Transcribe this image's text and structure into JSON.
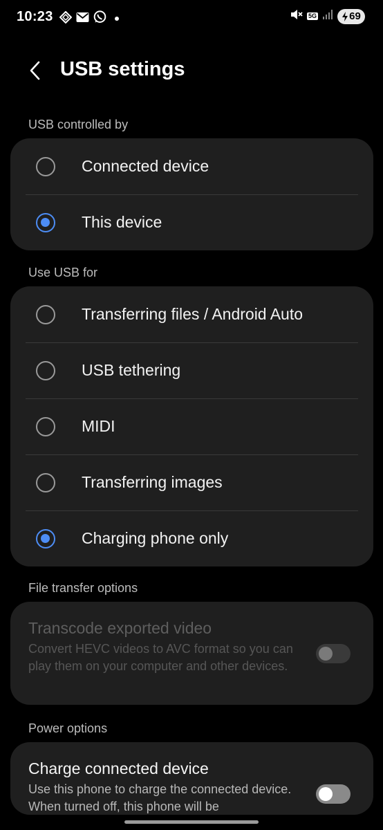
{
  "status_bar": {
    "time": "10:23",
    "network": "5G",
    "battery": "69",
    "left_icons": [
      "vpn-icon",
      "mail-icon",
      "whatsapp-icon",
      "notification-dot"
    ],
    "right_icons": [
      "mute-icon",
      "network-5g-icon",
      "signal-icon",
      "battery-charging-icon"
    ]
  },
  "header": {
    "title": "USB settings",
    "back_icon": "chevron-left-icon"
  },
  "sections": {
    "controlled_by": {
      "label": "USB controlled by",
      "options": [
        {
          "label": "Connected device",
          "selected": false
        },
        {
          "label": "This device",
          "selected": true
        }
      ]
    },
    "use_for": {
      "label": "Use USB for",
      "options": [
        {
          "label": "Transferring files / Android Auto",
          "selected": false
        },
        {
          "label": "USB tethering",
          "selected": false
        },
        {
          "label": "MIDI",
          "selected": false
        },
        {
          "label": "Transferring images",
          "selected": false
        },
        {
          "label": "Charging phone only",
          "selected": true
        }
      ]
    },
    "file_transfer": {
      "label": "File transfer options",
      "title": "Transcode exported video",
      "description": "Convert HEVC videos to AVC format so you can play them on your computer and other devices.",
      "enabled": false,
      "on": false
    },
    "power": {
      "label": "Power options",
      "title": "Charge connected device",
      "description": "Use this phone to charge the connected device. When turned off, this phone will be",
      "enabled": true,
      "on": false
    }
  },
  "colors": {
    "accent": "#4d8df5",
    "background": "#000000",
    "card": "#1f1f1f"
  }
}
